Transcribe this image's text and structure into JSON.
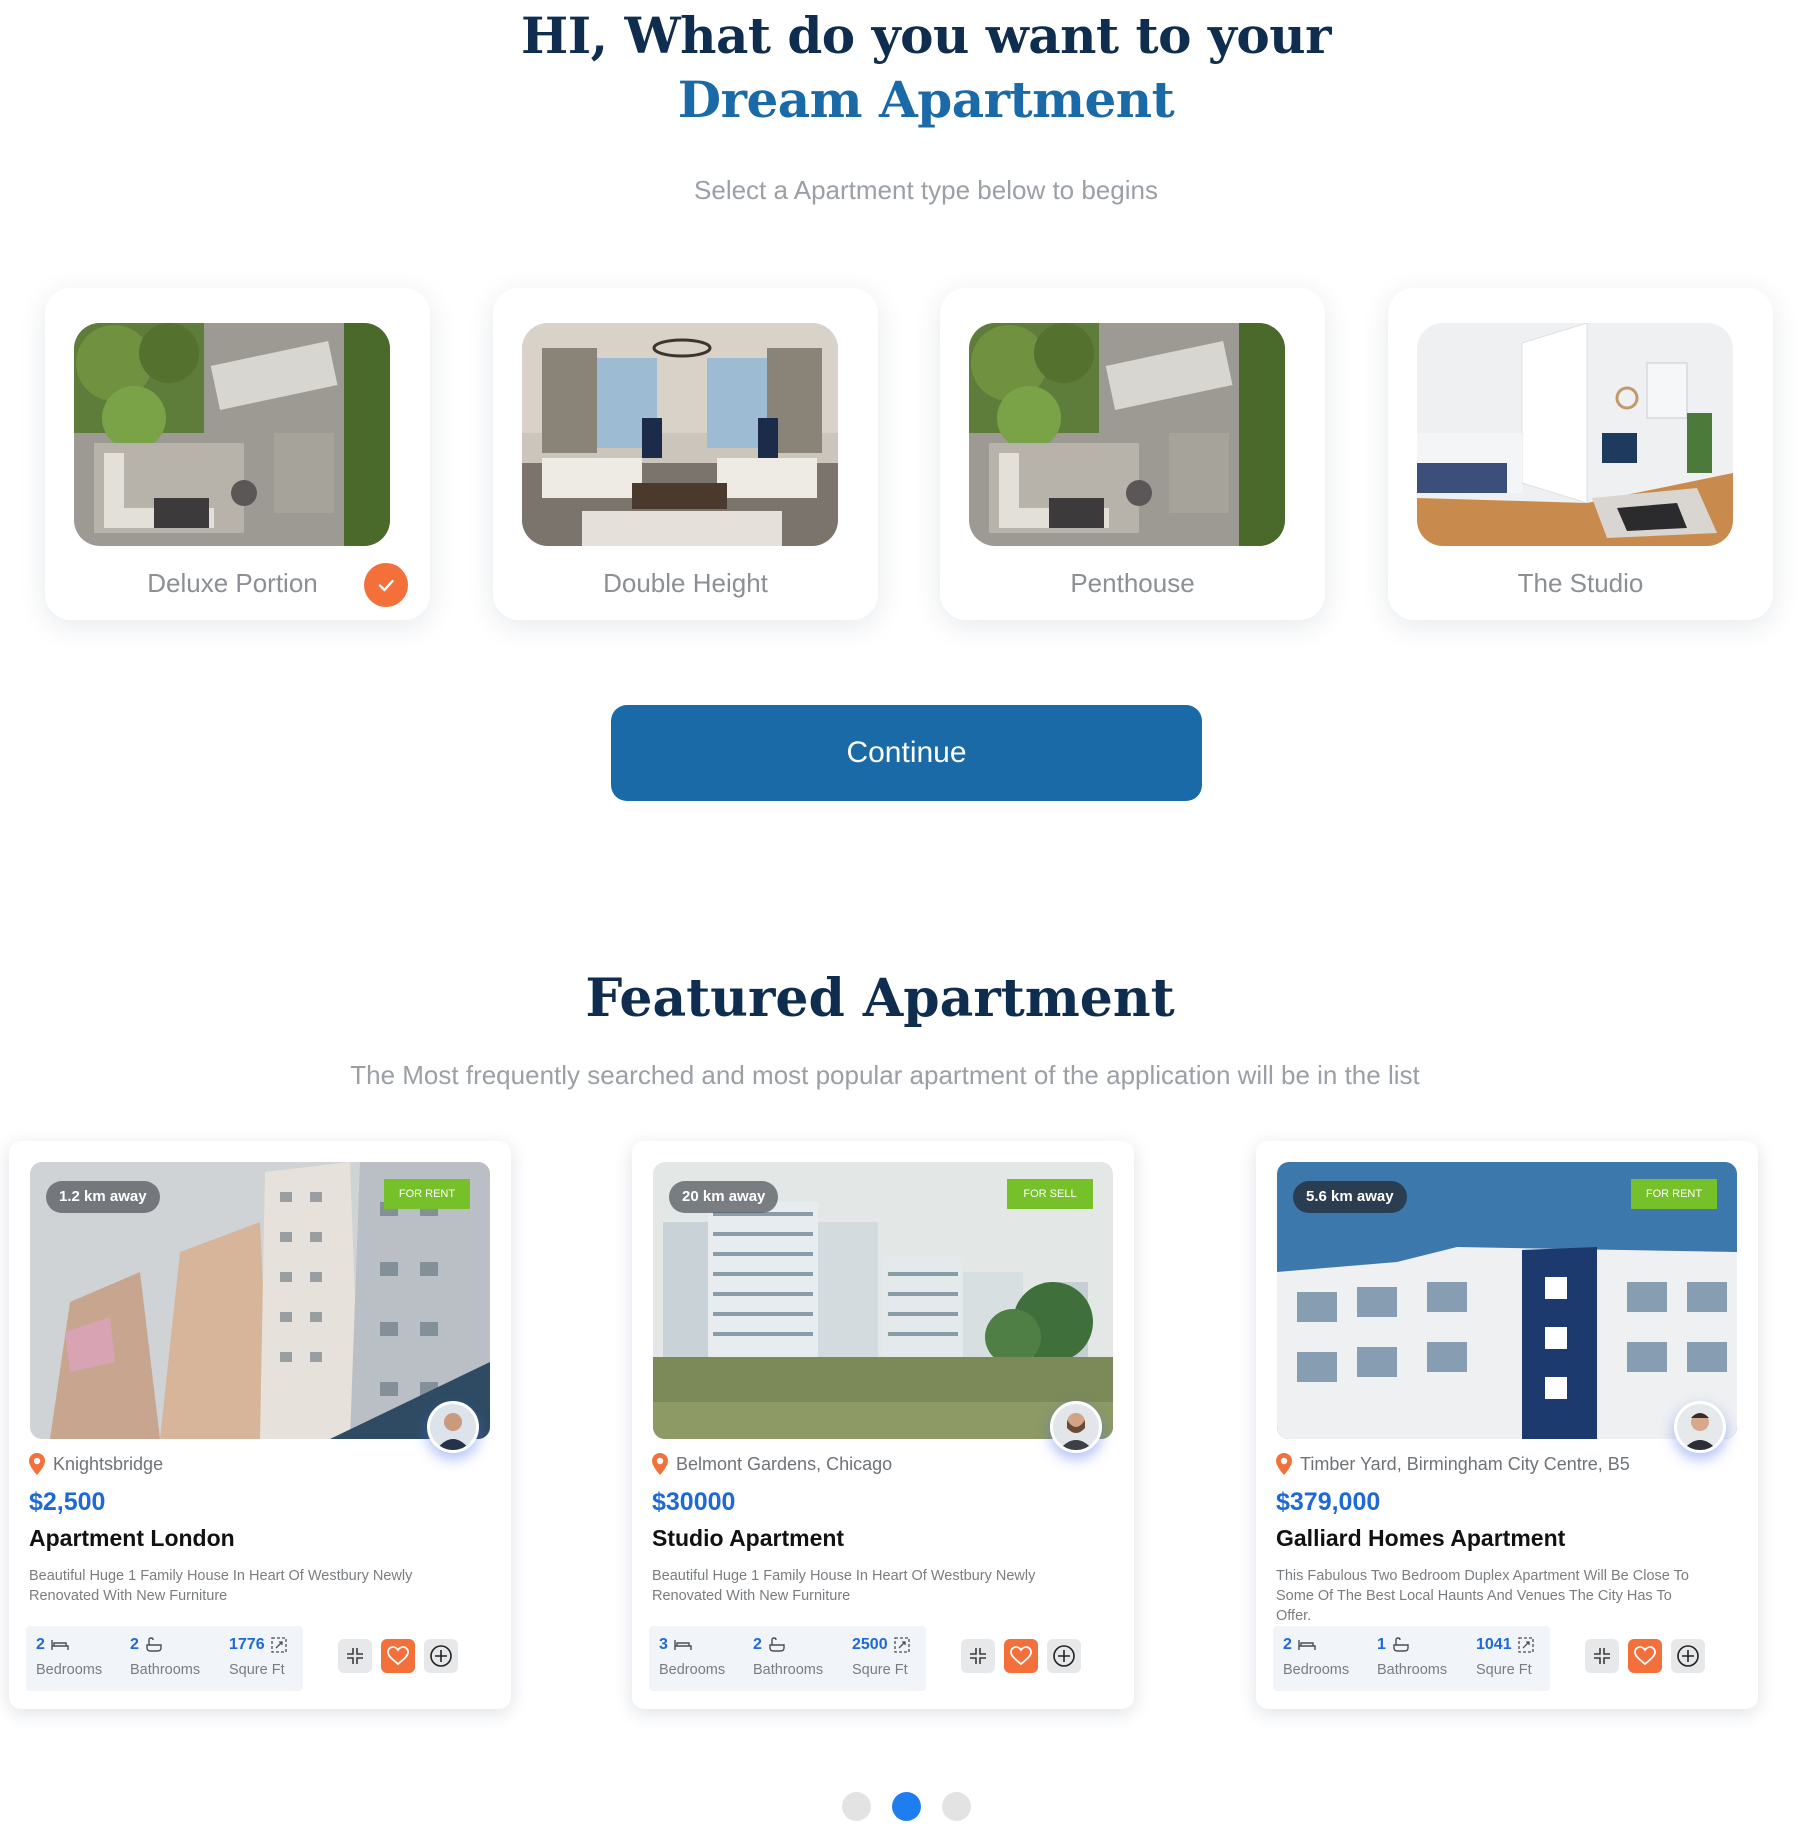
{
  "hero": {
    "line1": "HI, What do you want to your",
    "line2": "Dream Apartment",
    "subtitle": "Select a Apartment type below to begins"
  },
  "apartment_types": [
    {
      "label": "Deluxe Portion",
      "selected": true
    },
    {
      "label": "Double Height",
      "selected": false
    },
    {
      "label": "Penthouse",
      "selected": false
    },
    {
      "label": "The Studio",
      "selected": false
    }
  ],
  "continue_label": "Continue",
  "featured": {
    "title": "Featured Apartment",
    "subtitle": "The Most frequently searched and most popular apartment of the application will be in the list",
    "cards": [
      {
        "distance": "1.2 km away",
        "status": "FOR RENT",
        "location": "Knightsbridge",
        "price": "$2,500",
        "title": "Apartment London",
        "description": "Beautiful Huge 1 Family House In Heart Of Westbury Newly Renovated With New Furniture",
        "bedrooms": "2",
        "bathrooms": "2",
        "sqft": "1776",
        "bedrooms_label": "Bedrooms",
        "bathrooms_label": "Bathrooms",
        "sqft_label": "Squre Ft"
      },
      {
        "distance": "20 km away",
        "status": "FOR SELL",
        "location": "Belmont Gardens, Chicago",
        "price": "$30000",
        "title": "Studio Apartment",
        "description": "Beautiful Huge 1 Family House In Heart Of Westbury Newly Renovated With New Furniture",
        "bedrooms": "3",
        "bathrooms": "2",
        "sqft": "2500",
        "bedrooms_label": "Bedrooms",
        "bathrooms_label": "Bathrooms",
        "sqft_label": "Squre Ft"
      },
      {
        "distance": "5.6 km away",
        "status": "FOR RENT",
        "location": "Timber Yard, Birmingham City Centre, B5",
        "price": "$379,000",
        "title": "Galliard Homes Apartment",
        "description": "This Fabulous Two Bedroom Duplex Apartment Will Be Close To Some Of The Best Local Haunts And Venues The City Has To Offer.",
        "bedrooms": "2",
        "bathrooms": "1",
        "sqft": "1041",
        "bedrooms_label": "Bedrooms",
        "bathrooms_label": "Bathrooms",
        "sqft_label": "Squre Ft"
      }
    ]
  },
  "pagination": {
    "pages": 3,
    "active_page": 2
  },
  "colors": {
    "navy": "#0f2d4f",
    "brand_blue": "#1a6aa8",
    "price_blue": "#1e69d6",
    "accent_orange": "#f4703b",
    "tag_green": "#76c12a"
  },
  "icons": [
    "check-icon",
    "location-pin-icon",
    "bed-icon",
    "bath-icon",
    "area-icon",
    "compare-icon",
    "heart-icon",
    "plus-circle-icon"
  ]
}
